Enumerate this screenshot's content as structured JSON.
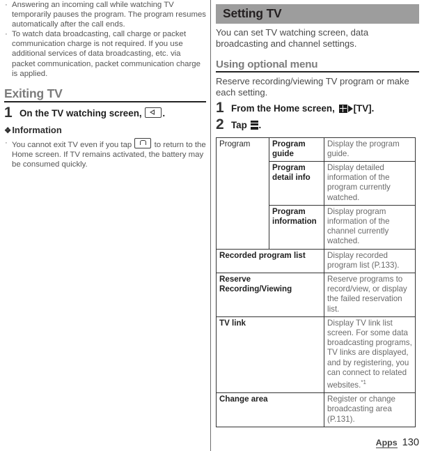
{
  "left_column": {
    "top_bullets": [
      "Answering an incoming call while watching TV temporarily pauses the program. The program resumes automatically after the call ends.",
      "To watch data broadcasting, call charge or packet communication charge is not required. If you use additional services of data broadcasting, etc. via packet communication, packet communication charge is applied."
    ],
    "exiting_heading": "Exiting TV",
    "step1": {
      "number": "1",
      "text_before_icon": "On the TV watching screen,",
      "icon": "back-key-icon",
      "text_after_icon": "."
    },
    "information_heading": "Information",
    "information_bullet": {
      "text_before_icon": "You cannot exit TV even if you tap",
      "icon": "home-key-icon",
      "text_after_icon": "to return to the Home screen. If TV remains activated, the battery may be consumed quickly."
    }
  },
  "right_column": {
    "banner_title": "Setting TV",
    "intro": "You can set TV watching screen, data broadcasting and channel settings.",
    "subheading": "Using optional menu",
    "subintro": "Reserve recording/viewing TV program or make each setting.",
    "step1": {
      "number": "1",
      "text_before_icon": "From the Home screen,",
      "icon_apps": "apps-grid-icon",
      "icon_arrow": "play-arrow-icon",
      "text_after_icon": "[TV]."
    },
    "step2": {
      "number": "2",
      "text_before_icon": "Tap",
      "icon_menu": "overflow-menu-icon",
      "text_after_icon": "."
    },
    "table": {
      "rows": [
        {
          "group": "Program",
          "item": "Program guide",
          "description": "Display the program guide."
        },
        {
          "group": "",
          "item": "Program detail info",
          "description": "Display detailed information of the program currently watched."
        },
        {
          "group": "",
          "item": "Program information",
          "description": "Display program information of the channel currently watched."
        },
        {
          "merged_item": "Recorded program list",
          "description": "Display recorded program list (P.133)."
        },
        {
          "merged_item": "Reserve Recording/Viewing",
          "description": "Reserve programs to record/view, or display the failed reservation list."
        },
        {
          "merged_item": "TV link",
          "description": "Display TV link list screen. For some data broadcasting programs, TV links are displayed, and by registering, you can connect to related websites.",
          "footnote": "*1"
        },
        {
          "merged_item": "Change area",
          "description": "Register or change broadcasting area (P.131)."
        }
      ]
    }
  },
  "footer": {
    "section_label": "Apps",
    "page_number": "130"
  }
}
